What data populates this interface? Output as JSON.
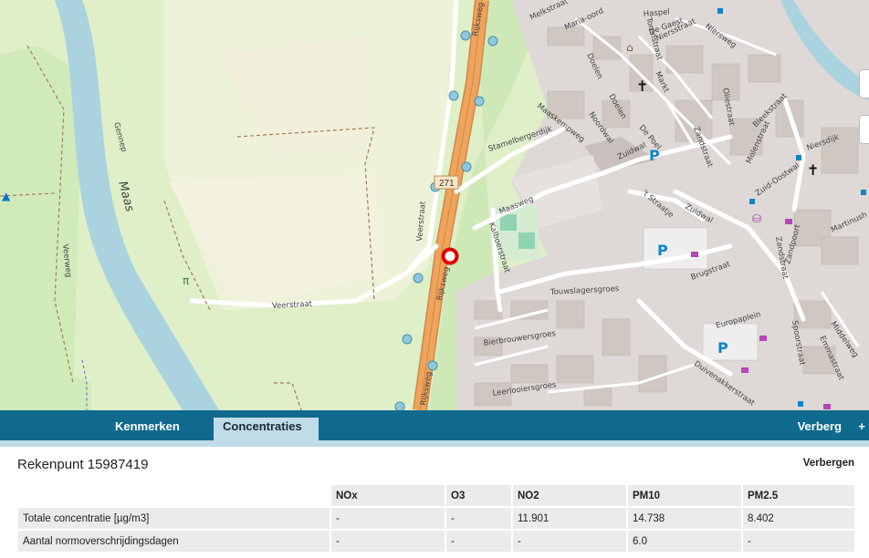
{
  "map": {
    "labels": {
      "rijksweg_a": "Rijksweg",
      "rijksweg_b": "Rijksweg",
      "rijksweg_c": "Rijksweg",
      "road_number": "271",
      "verstraat": "Veerstraat",
      "verstraat2": "Veerstraat",
      "veerweg": "Veerweg",
      "maas": "Maas",
      "gennep": "Gennep",
      "maasweg": "Maasweg",
      "stamelbergerdijk": "Stamelbergerdijk",
      "maaskempweg": "Maaskempweg",
      "kalboerstraat": "Kalboerstraat",
      "touwslagersgroes": "Touwslagersgroes",
      "bierbrouwersgroes": "Bierbrouwersgroes",
      "leerlooiersgroes": "Leerlooiersgroes",
      "brugstraat": "Brugstraat",
      "zuidwal": "Zuidwal",
      "zuidwal2": "Zuidwal",
      "straatje": "'t Straatje",
      "noordwal": "Noordwal",
      "doelen": "Doelen",
      "doelen2": "Doelen",
      "markt": "Markt",
      "niersstraat": "Niersstraat",
      "niersweg": "Niersweg",
      "torenstraat": "Torenstraat",
      "de_poel": "De Poel",
      "zandstraat": "Zandstraat",
      "zandstraat2": "Zandstraat",
      "oliestraat": "Oliestraat",
      "molenstraat": "Molenstraat",
      "bleekstraat": "Bleekstraat",
      "niersdijk": "Niersdijk",
      "zuid_oostwal": "Zuid-Oostwal",
      "zandpoort": "Zandpoort",
      "martinus": "Martinush",
      "europaplein": "Europaplein",
      "duivenakker": "Duivenakkerstraat",
      "spoorstraat": "Spoorstraat",
      "emmastraat": "Emmastraat",
      "middelweg": "Middelweg",
      "melkstraat": "Melkstraat",
      "mariaoord": "Maria-oord",
      "de_gaest": "De Gaest",
      "haspel": "Haspel"
    }
  },
  "tabs": {
    "kenmerken": "Kenmerken",
    "concentraties": "Concentraties",
    "verberg": "Verberg",
    "plus": "+"
  },
  "panel": {
    "title": "Rekenpunt 15987419",
    "hide_label": "Verbergen",
    "columns": [
      "",
      "NOx",
      "O3",
      "NO2",
      "PM10",
      "PM2.5"
    ],
    "rows": [
      [
        "Totale concentratie [µg/m3]",
        "-",
        "-",
        "11.901",
        "14.738",
        "8.402"
      ],
      [
        "Aantal normoverschrijdingsdagen",
        "-",
        "-",
        "-",
        "6.0",
        "-"
      ]
    ]
  },
  "colors": {
    "tab_bar": "#0f6a8e",
    "tab_active": "#bfdce8",
    "river": "#aad3df",
    "motorway": "#f0a35a",
    "marker": "#e00000"
  }
}
